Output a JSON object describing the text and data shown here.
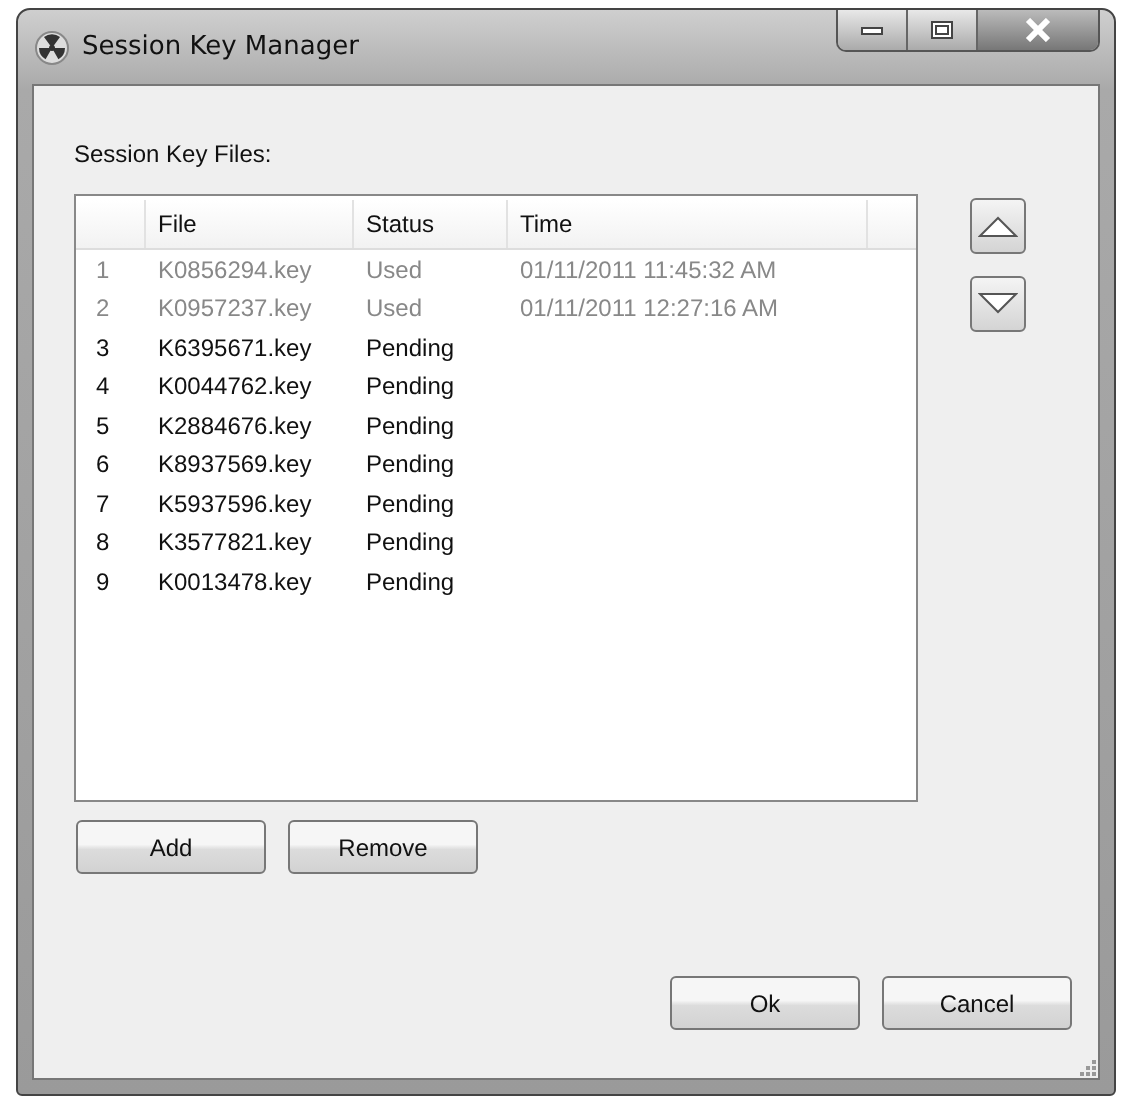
{
  "window": {
    "title": "Session Key Manager"
  },
  "label": "Session Key Files:",
  "table": {
    "columns": [
      "File",
      "Status",
      "Time"
    ],
    "rows": [
      {
        "number": "1",
        "file": "K0856294.key",
        "status": "Used",
        "time": "01/11/2011 11:45:32 AM",
        "disabled": true
      },
      {
        "number": "2",
        "file": "K0957237.key",
        "status": "Used",
        "time": "01/11/2011 12:27:16 AM",
        "disabled": true
      },
      {
        "number": "3",
        "file": "K6395671.key",
        "status": "Pending",
        "disabled": false
      },
      {
        "number": "4",
        "file": "K0044762.key",
        "status": "Pending",
        "disabled": false
      },
      {
        "number": "5",
        "file": "K2884676.key",
        "status": "Pending",
        "disabled": false
      },
      {
        "number": "6",
        "file": "K8937569.key",
        "status": "Pending",
        "disabled": false
      },
      {
        "number": "7",
        "file": "K5937596.key",
        "status": "Pending",
        "disabled": false
      },
      {
        "number": "8",
        "file": "K3577821.key",
        "status": "Pending",
        "disabled": false
      },
      {
        "number": "9",
        "file": "K0013478.key",
        "status": "Pending",
        "disabled": false
      }
    ]
  },
  "list_buttons": [
    "Add",
    "Remove"
  ],
  "dialog_buttons": [
    "Ok",
    "Cancel"
  ]
}
